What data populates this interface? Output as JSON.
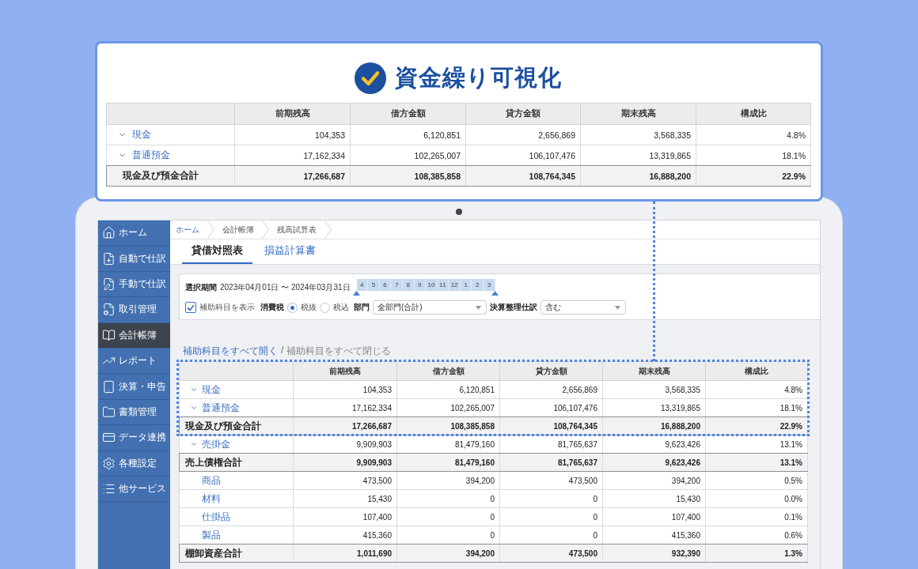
{
  "callout": {
    "title": "資金繰り可視化",
    "table": {
      "columns": [
        "前期残高",
        "借方金額",
        "貸方金額",
        "期末残高",
        "構成比"
      ],
      "rows": [
        {
          "kind": "group",
          "label": "現金",
          "values": [
            "104,353",
            "6,120,851",
            "2,656,869",
            "3,568,335",
            "4.8%"
          ]
        },
        {
          "kind": "group",
          "label": "普通預金",
          "values": [
            "17,162,334",
            "102,265,007",
            "106,107,476",
            "13,319,865",
            "18.1%"
          ]
        },
        {
          "kind": "total",
          "label": "現金及び預金合計",
          "values": [
            "17,266,687",
            "108,385,858",
            "108,764,345",
            "16,888,200",
            "22.9%"
          ]
        }
      ]
    }
  },
  "sidebar": {
    "items": [
      {
        "label": "ホーム",
        "selected": false
      },
      {
        "label": "自動で仕訳",
        "selected": false
      },
      {
        "label": "手動で仕訳",
        "selected": false
      },
      {
        "label": "取引管理",
        "selected": false
      },
      {
        "label": "会計帳簿",
        "selected": true
      },
      {
        "label": "レポート",
        "selected": false
      },
      {
        "label": "決算・申告",
        "selected": false
      },
      {
        "label": "書類管理",
        "selected": false
      },
      {
        "label": "データ連携",
        "selected": false
      },
      {
        "label": "各種設定",
        "selected": false
      },
      {
        "label": "他サービス",
        "selected": false
      }
    ]
  },
  "breadcrumb": [
    {
      "label": "ホーム",
      "link": true
    },
    {
      "label": "会計帳簿",
      "link": false
    },
    {
      "label": "残高試算表",
      "link": false
    }
  ],
  "tabs": [
    {
      "label": "貸借対照表",
      "selected": true
    },
    {
      "label": "損益計算書",
      "selected": false
    }
  ],
  "filters": {
    "period": {
      "label": "選択期間",
      "range": "2023年04月01日 〜 2024年03月31日",
      "months": [
        {
          "label": "4",
          "selected": true
        },
        {
          "label": "5",
          "selected": true
        },
        {
          "label": "6",
          "selected": true
        },
        {
          "label": "7",
          "selected": true
        },
        {
          "label": "8",
          "selected": true
        },
        {
          "label": "9",
          "selected": true
        },
        {
          "label": "10",
          "selected": true
        },
        {
          "label": "11",
          "selected": true
        },
        {
          "label": "12",
          "selected": true
        },
        {
          "label": "1",
          "selected": true
        },
        {
          "label": "2",
          "selected": true
        },
        {
          "label": "3",
          "selected": true
        }
      ]
    },
    "show_subaccounts": {
      "label": "補助科目を表示",
      "checked": true
    },
    "tax": {
      "label": "消費税",
      "options": [
        {
          "label": "税抜",
          "selected": true
        },
        {
          "label": "税込",
          "selected": false
        }
      ]
    },
    "department": {
      "label": "部門",
      "value": "全部門(合計)"
    },
    "closing_entries": {
      "label": "決算整理仕訳",
      "value": "含む"
    }
  },
  "subaccount_links": {
    "items": [
      {
        "label": "補助科目をすべて開く",
        "disabled": false
      },
      {
        "label": "補助科目をすべて閉じる",
        "disabled": true
      }
    ],
    "separator": "/"
  },
  "table": {
    "columns": [
      "前期残高",
      "借方金額",
      "貸方金額",
      "期末残高",
      "構成比"
    ],
    "rows": [
      {
        "kind": "group",
        "label": "現金",
        "highlighted": true,
        "values": [
          "104,353",
          "6,120,851",
          "2,656,869",
          "3,568,335",
          "4.8%"
        ]
      },
      {
        "kind": "group",
        "label": "普通預金",
        "highlighted": true,
        "values": [
          "17,162,334",
          "102,265,007",
          "106,107,476",
          "13,319,865",
          "18.1%"
        ]
      },
      {
        "kind": "total",
        "label": "現金及び預金合計",
        "highlighted": true,
        "values": [
          "17,266,687",
          "108,385,858",
          "108,764,345",
          "16,888,200",
          "22.9%"
        ]
      },
      {
        "kind": "group",
        "label": "売掛金",
        "highlighted": false,
        "values": [
          "9,909,903",
          "81,479,160",
          "81,765,637",
          "9,623,426",
          "13.1%"
        ]
      },
      {
        "kind": "total",
        "label": "売上債権合計",
        "highlighted": false,
        "values": [
          "9,909,903",
          "81,479,160",
          "81,765,637",
          "9,623,426",
          "13.1%"
        ]
      },
      {
        "kind": "item",
        "label": "商品",
        "highlighted": false,
        "values": [
          "473,500",
          "394,200",
          "473,500",
          "394,200",
          "0.5%"
        ]
      },
      {
        "kind": "item",
        "label": "材料",
        "highlighted": false,
        "values": [
          "15,430",
          "0",
          "0",
          "15,430",
          "0.0%"
        ]
      },
      {
        "kind": "item",
        "label": "仕掛品",
        "highlighted": false,
        "values": [
          "107,400",
          "0",
          "0",
          "107,400",
          "0.1%"
        ]
      },
      {
        "kind": "item",
        "label": "製品",
        "highlighted": false,
        "values": [
          "415,360",
          "0",
          "0",
          "415,360",
          "0.6%"
        ]
      },
      {
        "kind": "total",
        "label": "棚卸資産合計",
        "highlighted": false,
        "values": [
          "1,011,690",
          "394,200",
          "473,500",
          "932,390",
          "1.3%"
        ]
      }
    ]
  }
}
